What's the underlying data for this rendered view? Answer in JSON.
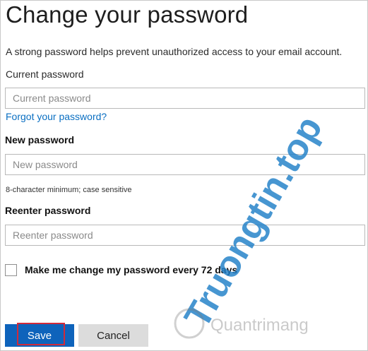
{
  "header": {
    "title": "Change your password"
  },
  "intro": {
    "text": "A strong password helps prevent unauthorized access to your email account."
  },
  "current_password": {
    "label": "Current password",
    "placeholder": "Current password"
  },
  "forgot_link": {
    "label": "Forgot your password?"
  },
  "new_password": {
    "label": "New password",
    "placeholder": "New password",
    "hint": "8-character minimum; case sensitive"
  },
  "reenter_password": {
    "label": "Reenter password",
    "placeholder": "Reenter password"
  },
  "expiry_checkbox": {
    "label": "Make me change my password every 72 days",
    "checked": false
  },
  "buttons": {
    "save": "Save",
    "cancel": "Cancel"
  },
  "watermark": {
    "text": "Truongtin.top",
    "subtext": "Quantrimang"
  },
  "colors": {
    "accent": "#0e63bb",
    "link": "#0a6fc2",
    "focus_outline": "#d12a3a",
    "watermark": "#1f7fc8"
  }
}
